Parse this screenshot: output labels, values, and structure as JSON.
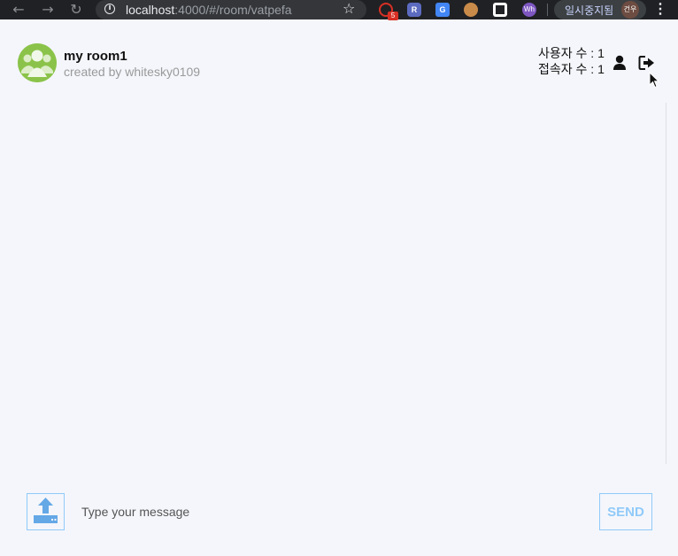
{
  "browser": {
    "url_host": "localhost",
    "url_path": ":4000/#/room/vatpefa",
    "extension_badge": "5",
    "ext_r_label": "R",
    "ext_g_label": "G",
    "ext_w_label": "Wh",
    "profile_label": "일시중지됨",
    "avatar_text": "건우"
  },
  "room": {
    "title": "my room1",
    "created_by": "created by whitesky0109",
    "user_count_label": "사용자 수 : 1",
    "connected_count_label": "접속자 수 : 1"
  },
  "composer": {
    "placeholder": "Type your message",
    "send_label": "SEND"
  },
  "colors": {
    "accent": "#90caf9",
    "avatar_green": "#8bc34a",
    "background": "#f4f6fb"
  }
}
